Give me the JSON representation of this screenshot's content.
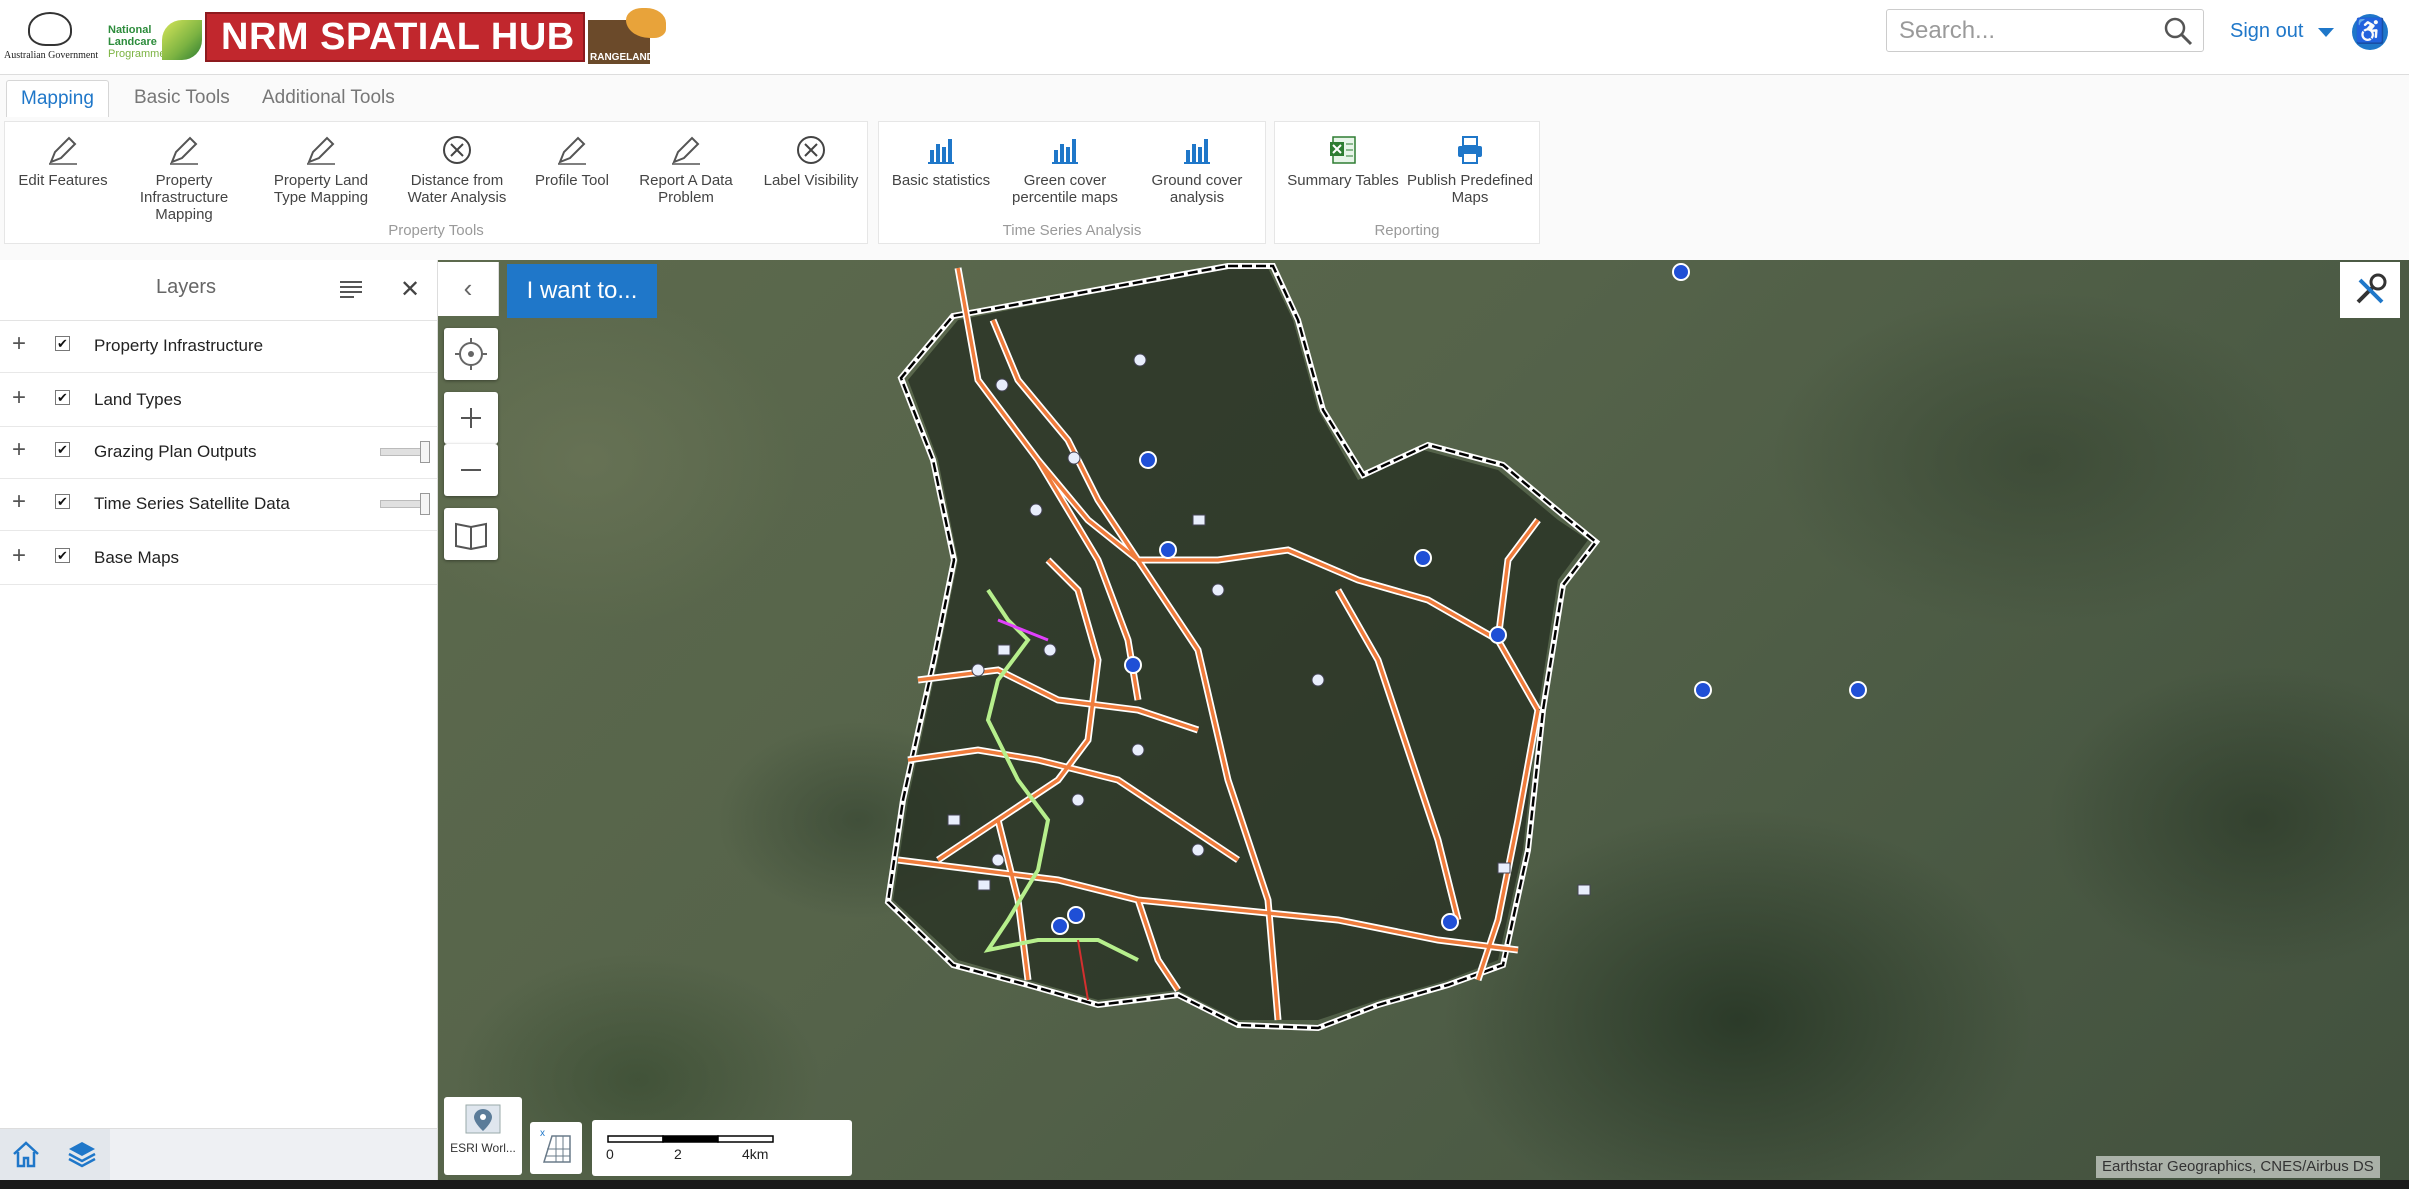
{
  "header": {
    "gov_logo_text": "Australian Government",
    "landcare_line1": "National",
    "landcare_line2": "Landcare",
    "landcare_line3": "Programme",
    "banner_title": "NRM SPATIAL HUB",
    "rangeland_text": "RANGELAND",
    "search_placeholder": "Search...",
    "sign_out": "Sign out"
  },
  "ribbon": {
    "tabs": [
      "Mapping",
      "Basic Tools",
      "Additional Tools"
    ],
    "active_tab": "Mapping",
    "groups": [
      {
        "label": "Property Tools",
        "tools": [
          "Edit Features",
          "Property Infrastructure Mapping",
          "Property Land Type Mapping",
          "Distance from Water Analysis",
          "Profile Tool",
          "Report A Data Problem",
          "Label Visibility"
        ]
      },
      {
        "label": "Time Series Analysis",
        "tools": [
          "Basic statistics",
          "Green cover percentile maps",
          "Ground cover analysis"
        ]
      },
      {
        "label": "Reporting",
        "tools": [
          "Summary Tables",
          "Publish Predefined Maps"
        ]
      }
    ]
  },
  "layers": {
    "title": "Layers",
    "items": [
      {
        "label": "Property Infrastructure",
        "checked": true,
        "slider": false
      },
      {
        "label": "Land Types",
        "checked": true,
        "slider": false
      },
      {
        "label": "Grazing Plan Outputs",
        "checked": true,
        "slider": true
      },
      {
        "label": "Time Series Satellite Data",
        "checked": true,
        "slider": true
      },
      {
        "label": "Base Maps",
        "checked": true,
        "slider": false
      }
    ]
  },
  "map": {
    "i_want_to": "I want to...",
    "basemap_label": "ESRI Worl...",
    "scale_ticks": [
      "0",
      "2",
      "4km"
    ],
    "attribution": "Earthstar Geographics, CNES/Airbus DS"
  },
  "colors": {
    "accent": "#1f77c9",
    "banner": "#c1272d",
    "track_orange": "#f07c3c",
    "boundary": "#000000",
    "green_route": "#b6ef8c"
  }
}
